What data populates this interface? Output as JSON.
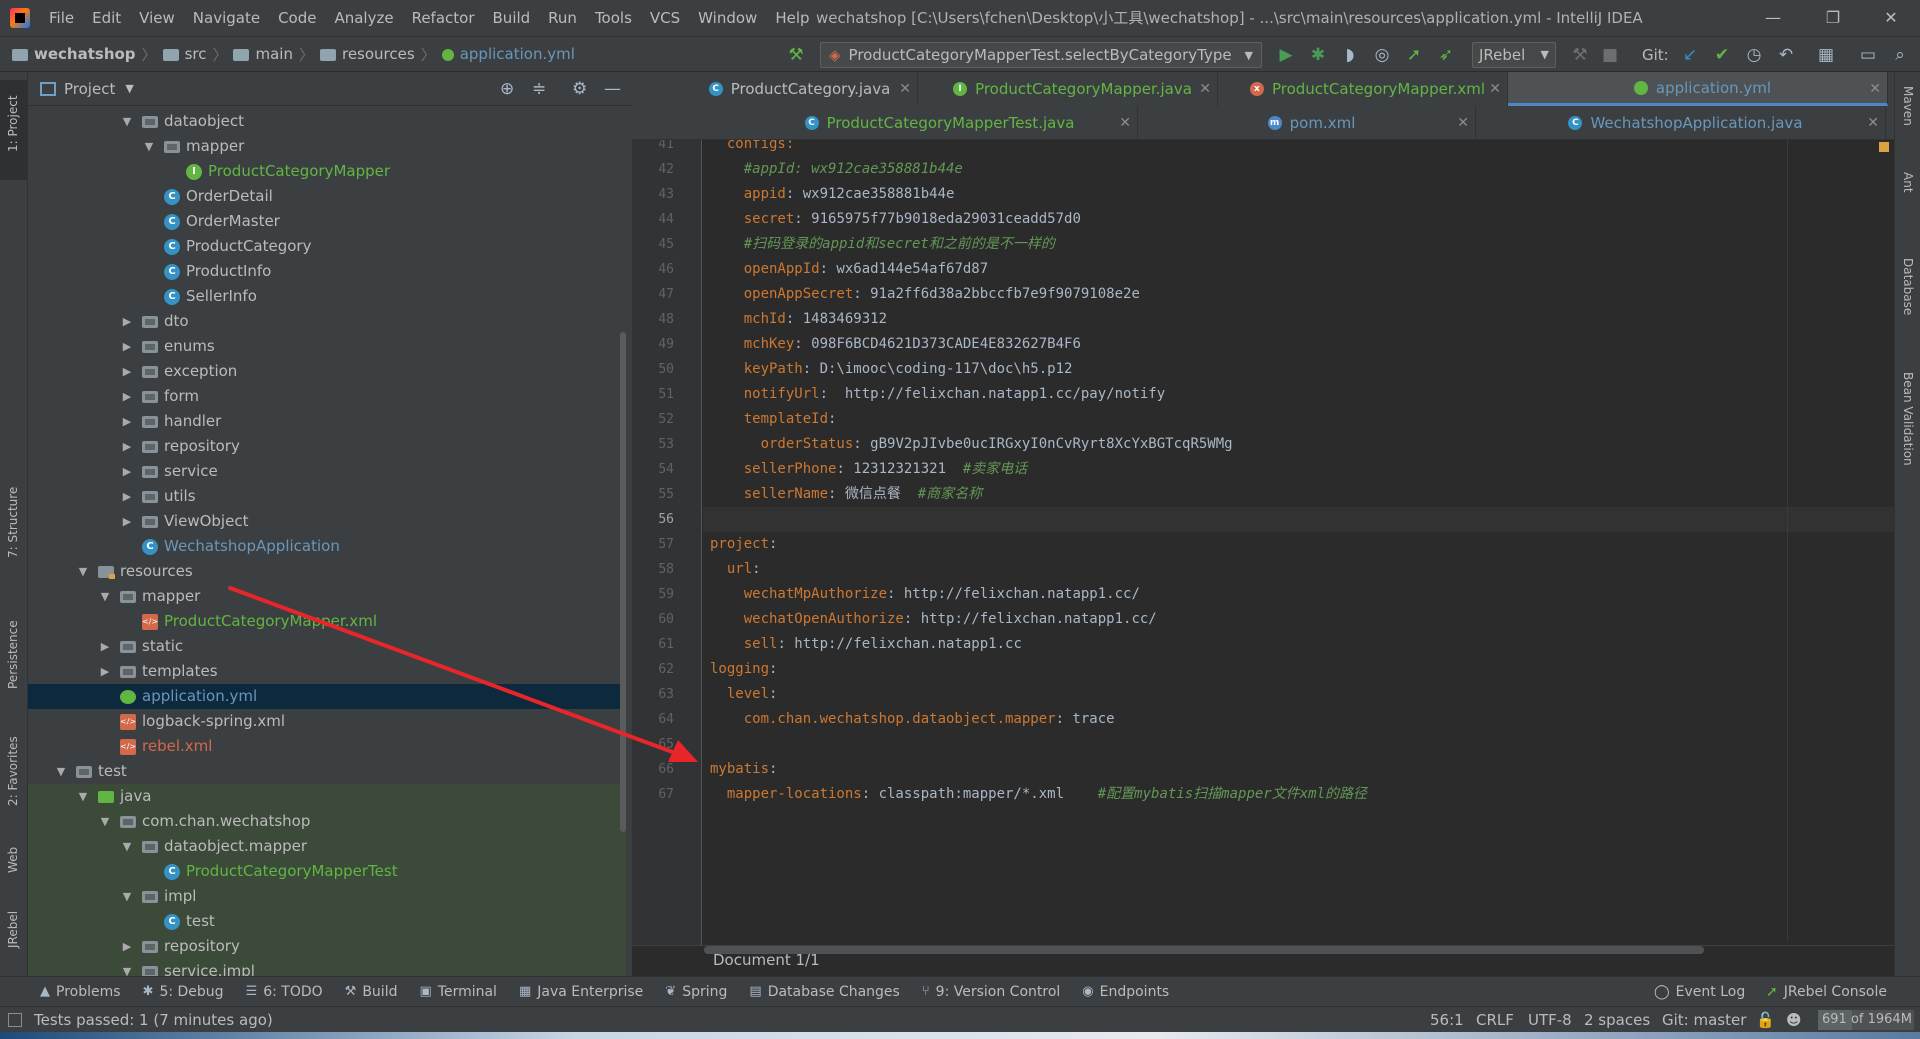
{
  "titlebar": {
    "menu": [
      "File",
      "Edit",
      "View",
      "Navigate",
      "Code",
      "Analyze",
      "Refactor",
      "Build",
      "Run",
      "Tools",
      "VCS",
      "Window",
      "Help"
    ],
    "window_title": "wechatshop [C:\\Users\\fchen\\Desktop\\小工具\\wechatshop] - ...\\src\\main\\resources\\application.yml - IntelliJ IDEA"
  },
  "navbar": {
    "breadcrumbs": [
      "wechatshop",
      "src",
      "main",
      "resources",
      "application.yml"
    ],
    "run_config": "ProductCategoryMapperTest.selectByCategoryType",
    "jrebel": "JRebel",
    "git_label": "Git:"
  },
  "left_strip": {
    "tabs": [
      "1: Project",
      "7: Structure",
      "Persistence",
      "2: Favorites",
      "Web",
      "JRebel"
    ]
  },
  "project": {
    "header": "Project",
    "tree": [
      {
        "indent": 4,
        "arrow": "▼",
        "icon": "folder",
        "label": "dataobject",
        "color": "default"
      },
      {
        "indent": 5,
        "arrow": "▼",
        "icon": "folder",
        "label": "mapper",
        "color": "default"
      },
      {
        "indent": 6,
        "arrow": "",
        "icon": "intf",
        "label": "ProductCategoryMapper",
        "color": "green"
      },
      {
        "indent": 5,
        "arrow": "",
        "icon": "cls",
        "label": "OrderDetail",
        "color": "default"
      },
      {
        "indent": 5,
        "arrow": "",
        "icon": "cls",
        "label": "OrderMaster",
        "color": "default"
      },
      {
        "indent": 5,
        "arrow": "",
        "icon": "cls",
        "label": "ProductCategory",
        "color": "default"
      },
      {
        "indent": 5,
        "arrow": "",
        "icon": "cls",
        "label": "ProductInfo",
        "color": "default"
      },
      {
        "indent": 5,
        "arrow": "",
        "icon": "cls",
        "label": "SellerInfo",
        "color": "default"
      },
      {
        "indent": 4,
        "arrow": "▶",
        "icon": "folder",
        "label": "dto",
        "color": "default"
      },
      {
        "indent": 4,
        "arrow": "▶",
        "icon": "folder",
        "label": "enums",
        "color": "default"
      },
      {
        "indent": 4,
        "arrow": "▶",
        "icon": "folder",
        "label": "exception",
        "color": "default"
      },
      {
        "indent": 4,
        "arrow": "▶",
        "icon": "folder",
        "label": "form",
        "color": "default"
      },
      {
        "indent": 4,
        "arrow": "▶",
        "icon": "folder",
        "label": "handler",
        "color": "default"
      },
      {
        "indent": 4,
        "arrow": "▶",
        "icon": "folder",
        "label": "repository",
        "color": "default"
      },
      {
        "indent": 4,
        "arrow": "▶",
        "icon": "folder",
        "label": "service",
        "color": "default"
      },
      {
        "indent": 4,
        "arrow": "▶",
        "icon": "folder",
        "label": "utils",
        "color": "default"
      },
      {
        "indent": 4,
        "arrow": "▶",
        "icon": "folder",
        "label": "ViewObject",
        "color": "default"
      },
      {
        "indent": 4,
        "arrow": "",
        "icon": "spring",
        "label": "WechatshopApplication",
        "color": "blue"
      },
      {
        "indent": 2,
        "arrow": "▼",
        "icon": "res-folder",
        "label": "resources",
        "color": "default"
      },
      {
        "indent": 3,
        "arrow": "▼",
        "icon": "folder",
        "label": "mapper",
        "color": "default"
      },
      {
        "indent": 4,
        "arrow": "",
        "icon": "xml",
        "label": "ProductCategoryMapper.xml",
        "color": "green"
      },
      {
        "indent": 3,
        "arrow": "▶",
        "icon": "folder",
        "label": "static",
        "color": "default"
      },
      {
        "indent": 3,
        "arrow": "▶",
        "icon": "folder",
        "label": "templates",
        "color": "default"
      },
      {
        "indent": 3,
        "arrow": "",
        "icon": "yml",
        "label": "application.yml",
        "color": "blue",
        "selected": true
      },
      {
        "indent": 3,
        "arrow": "",
        "icon": "xml",
        "label": "logback-spring.xml",
        "color": "default"
      },
      {
        "indent": 3,
        "arrow": "",
        "icon": "xml",
        "label": "rebel.xml",
        "color": "orange"
      },
      {
        "indent": 1,
        "arrow": "▼",
        "icon": "folder",
        "label": "test",
        "color": "default"
      },
      {
        "indent": 2,
        "arrow": "▼",
        "icon": "src-test",
        "label": "java",
        "color": "default",
        "testzone": true
      },
      {
        "indent": 3,
        "arrow": "▼",
        "icon": "folder",
        "label": "com.chan.wechatshop",
        "color": "default",
        "testzone": true
      },
      {
        "indent": 4,
        "arrow": "▼",
        "icon": "folder",
        "label": "dataobject.mapper",
        "color": "default",
        "testzone": true
      },
      {
        "indent": 5,
        "arrow": "",
        "icon": "cls",
        "label": "ProductCategoryMapperTest",
        "color": "green",
        "testzone": true
      },
      {
        "indent": 4,
        "arrow": "▼",
        "icon": "folder",
        "label": "impl",
        "color": "default",
        "testzone": true
      },
      {
        "indent": 5,
        "arrow": "",
        "icon": "cls",
        "label": "test",
        "color": "default",
        "testzone": true
      },
      {
        "indent": 4,
        "arrow": "▶",
        "icon": "folder",
        "label": "repository",
        "color": "default",
        "testzone": true
      },
      {
        "indent": 4,
        "arrow": "▼",
        "icon": "folder",
        "label": "service.impl",
        "color": "default",
        "testzone": true
      }
    ]
  },
  "tabs": {
    "row1": [
      {
        "label": "ProductCategory.java",
        "icon": "C",
        "color": "#3592c4",
        "text": "#bbbbbb"
      },
      {
        "label": "ProductCategoryMapper.java",
        "icon": "I",
        "color": "#62b543",
        "text": "#62b543"
      },
      {
        "label": "ProductCategoryMapper.xml",
        "icon": "x",
        "color": "#d1694a",
        "text": "#62b543"
      },
      {
        "label": "application.yml",
        "icon": "",
        "color": "#62b543",
        "text": "#6897bb",
        "active": true
      }
    ],
    "row2": [
      {
        "label": "ProductCategoryMapperTest.java",
        "icon": "C",
        "color": "#3592c4",
        "text": "#62b543"
      },
      {
        "label": "pom.xml",
        "icon": "m",
        "color": "#4a88c7",
        "text": "#6897bb"
      },
      {
        "label": "WechatshopApplication.java",
        "icon": "C",
        "color": "#3592c4",
        "text": "#6897bb"
      }
    ]
  },
  "editor": {
    "current_line": 56,
    "lines": [
      {
        "n": 41,
        "parts": [
          [
            "k",
            "  configs:"
          ]
        ]
      },
      {
        "n": 42,
        "parts": [
          [
            "c",
            "    #appId: wx912cae358881b44e"
          ]
        ]
      },
      {
        "n": 43,
        "parts": [
          [
            "k",
            "    appid"
          ],
          [
            "v",
            ": wx912cae358881b44e"
          ]
        ]
      },
      {
        "n": 44,
        "parts": [
          [
            "k",
            "    secret"
          ],
          [
            "v",
            ": 9165975f77b9018eda29031ceadd57d0"
          ]
        ]
      },
      {
        "n": 45,
        "parts": [
          [
            "c",
            "    #扫码登录的appid和secret和之前的是不一样的"
          ]
        ]
      },
      {
        "n": 46,
        "parts": [
          [
            "k",
            "    openAppId"
          ],
          [
            "v",
            ": wx6ad144e54af67d87"
          ]
        ]
      },
      {
        "n": 47,
        "parts": [
          [
            "k",
            "    openAppSecret"
          ],
          [
            "v",
            ": 91a2ff6d38a2bbccfb7e9f9079108e2e"
          ]
        ]
      },
      {
        "n": 48,
        "parts": [
          [
            "k",
            "    mchId"
          ],
          [
            "v",
            ": 1483469312"
          ]
        ]
      },
      {
        "n": 49,
        "parts": [
          [
            "k",
            "    mchKey"
          ],
          [
            "v",
            ": 098F6BCD4621D373CADE4E832627B4F6"
          ]
        ]
      },
      {
        "n": 50,
        "parts": [
          [
            "k",
            "    keyPath"
          ],
          [
            "v",
            ": D:\\imooc\\coding-117\\doc\\h5.p12"
          ]
        ]
      },
      {
        "n": 51,
        "parts": [
          [
            "k",
            "    notifyUrl"
          ],
          [
            "v",
            ":  http://felixchan.natapp1.cc/pay/notify"
          ]
        ]
      },
      {
        "n": 52,
        "parts": [
          [
            "k",
            "    templateId"
          ],
          [
            "v",
            ":"
          ]
        ]
      },
      {
        "n": 53,
        "parts": [
          [
            "k",
            "      orderStatus"
          ],
          [
            "v",
            ": gB9V2pJIvbe0ucIRGxyI0nCvRyrt8XcYxBGTcqR5WMg"
          ]
        ]
      },
      {
        "n": 54,
        "parts": [
          [
            "k",
            "    sellerPhone"
          ],
          [
            "v",
            ": 12312321321  "
          ],
          [
            "c",
            "#卖家电话"
          ]
        ]
      },
      {
        "n": 55,
        "parts": [
          [
            "k",
            "    sellerName"
          ],
          [
            "v",
            ": 微信点餐  "
          ],
          [
            "c",
            "#商家名称"
          ]
        ]
      },
      {
        "n": 56,
        "parts": [
          [
            "v",
            ""
          ]
        ]
      },
      {
        "n": 57,
        "parts": [
          [
            "k",
            "project"
          ],
          [
            "v",
            ":"
          ]
        ]
      },
      {
        "n": 58,
        "parts": [
          [
            "k",
            "  url"
          ],
          [
            "v",
            ":"
          ]
        ]
      },
      {
        "n": 59,
        "parts": [
          [
            "k",
            "    wechatMpAuthorize"
          ],
          [
            "v",
            ": http://felixchan.natapp1.cc/"
          ]
        ]
      },
      {
        "n": 60,
        "parts": [
          [
            "k",
            "    wechatOpenAuthorize"
          ],
          [
            "v",
            ": http://felixchan.natapp1.cc/"
          ]
        ]
      },
      {
        "n": 61,
        "parts": [
          [
            "k",
            "    sell"
          ],
          [
            "v",
            ": http://felixchan.natapp1.cc"
          ]
        ]
      },
      {
        "n": 62,
        "parts": [
          [
            "k",
            "logging"
          ],
          [
            "v",
            ":"
          ]
        ]
      },
      {
        "n": 63,
        "parts": [
          [
            "k",
            "  level"
          ],
          [
            "v",
            ":"
          ]
        ]
      },
      {
        "n": 64,
        "parts": [
          [
            "k",
            "    com.chan.wechatshop.dataobject.mapper"
          ],
          [
            "v",
            ": trace"
          ]
        ]
      },
      {
        "n": 65,
        "parts": [
          [
            "v",
            ""
          ]
        ]
      },
      {
        "n": 66,
        "parts": [
          [
            "k",
            "mybatis"
          ],
          [
            "v",
            ":"
          ]
        ]
      },
      {
        "n": 67,
        "parts": [
          [
            "k",
            "  mapper-locations"
          ],
          [
            "v",
            ": classpath:mapper/*.xml    "
          ],
          [
            "c",
            "#配置mybatis扫描mapper文件xml的路径"
          ]
        ]
      }
    ],
    "footer": "Document 1/1"
  },
  "right_strip": {
    "tabs": [
      "Maven",
      "Ant",
      "Database",
      "Bean Validation"
    ]
  },
  "bottom_tools": {
    "items": [
      {
        "icon": "▲",
        "label": "Problems"
      },
      {
        "icon": "✱",
        "label": "5: Debug"
      },
      {
        "icon": "☰",
        "label": "6: TODO"
      },
      {
        "icon": "⚒",
        "label": "Build"
      },
      {
        "icon": "▣",
        "label": "Terminal"
      },
      {
        "icon": "▦",
        "label": "Java Enterprise"
      },
      {
        "icon": "❦",
        "label": "Spring"
      },
      {
        "icon": "▤",
        "label": "Database Changes"
      },
      {
        "icon": "⑂",
        "label": "9: Version Control"
      },
      {
        "icon": "◉",
        "label": "Endpoints"
      }
    ],
    "event_log": "Event Log",
    "jrebel_console": "JRebel Console"
  },
  "status": {
    "message": "Tests passed: 1 (7 minutes ago)",
    "position": "56:1",
    "line_sep": "CRLF",
    "encoding": "UTF-8",
    "indent": "2 spaces",
    "git": "Git: master",
    "memory": "691 of 1964M"
  },
  "colors": {
    "accent": "#4a88c7",
    "annotation_arrow": "#e8262a"
  }
}
